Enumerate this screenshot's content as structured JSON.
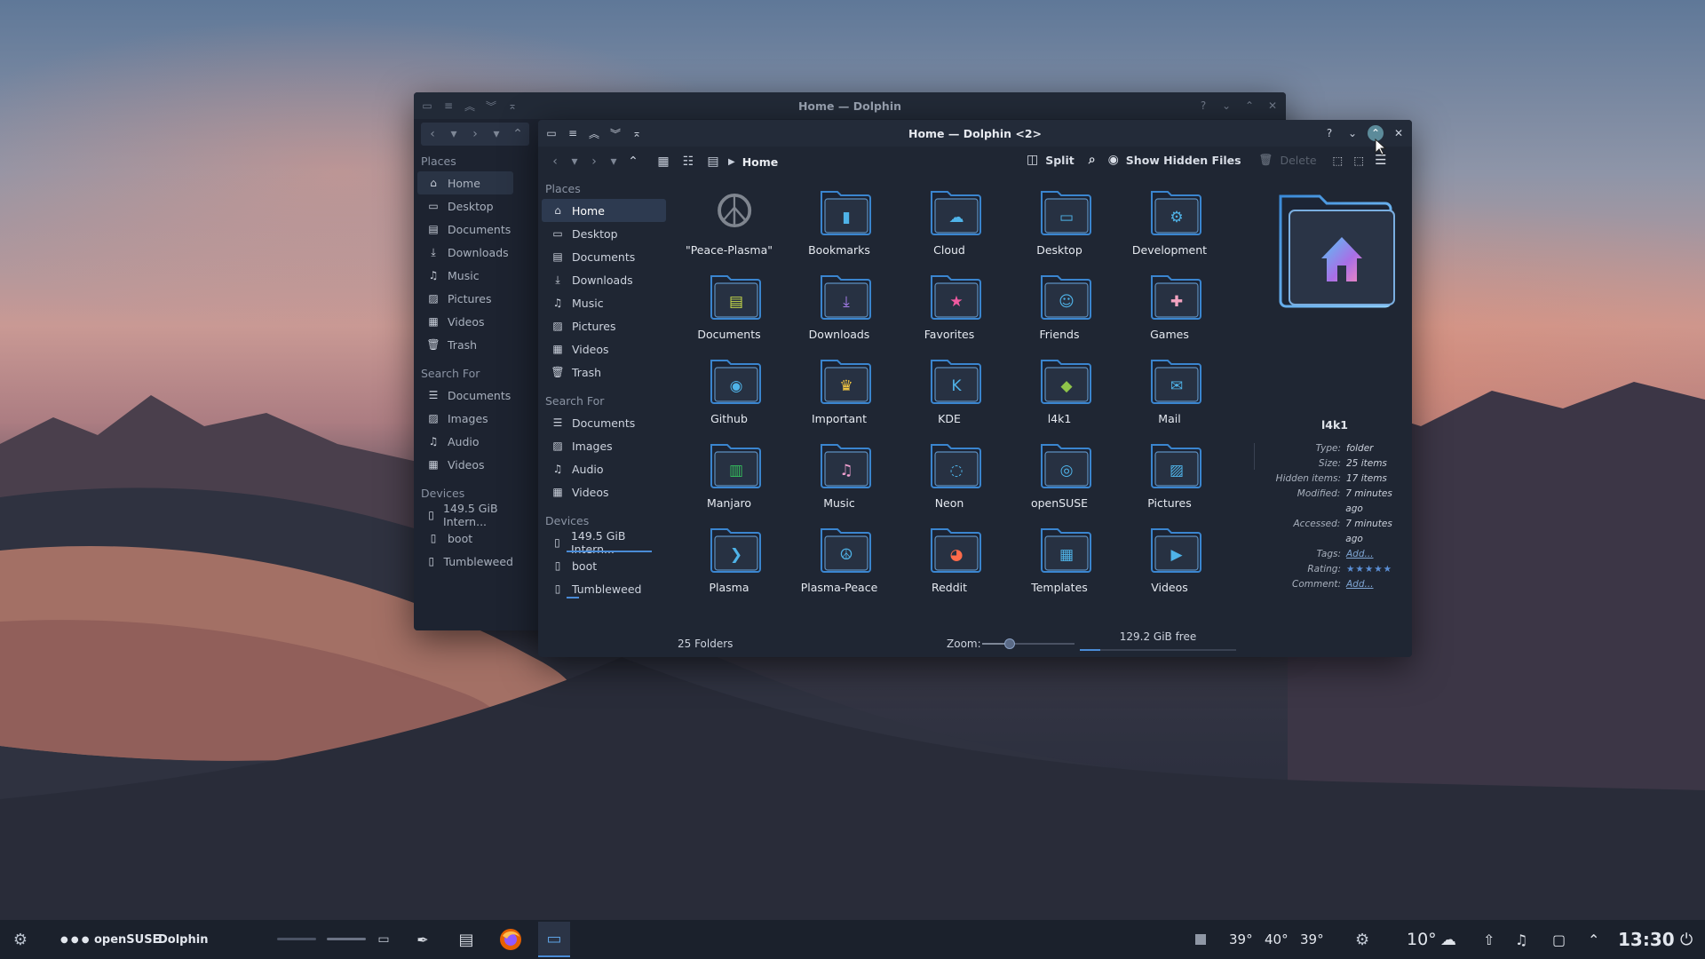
{
  "desktop": {
    "background": "desert-dunes-sunset"
  },
  "back_window": {
    "title": "Home — Dolphin",
    "places_header": "Places",
    "places": [
      "Home",
      "Desktop",
      "Documents",
      "Downloads",
      "Music",
      "Pictures",
      "Videos",
      "Trash"
    ],
    "search_header": "Search For",
    "search": [
      "Documents",
      "Images",
      "Audio",
      "Videos"
    ],
    "devices_header": "Devices",
    "devices": [
      "149.5 GiB Intern...",
      "boot",
      "Tumbleweed"
    ]
  },
  "front_window": {
    "title": "Home — Dolphin <2>",
    "breadcrumb": "Home",
    "toolbar": {
      "split": "Split",
      "show_hidden": "Show Hidden Files",
      "delete": "Delete"
    },
    "places_header": "Places",
    "places": [
      "Home",
      "Desktop",
      "Documents",
      "Downloads",
      "Music",
      "Pictures",
      "Videos",
      "Trash"
    ],
    "search_header": "Search For",
    "search": [
      "Documents",
      "Images",
      "Audio",
      "Videos"
    ],
    "devices_header": "Devices",
    "devices": [
      "149.5 GiB Intern...",
      "boot",
      "Tumbleweed"
    ],
    "folders": [
      {
        "name": "\"Peace-Plasma\"",
        "emblem": "peace-icon"
      },
      {
        "name": "Bookmarks",
        "emblem": "bookmark-icon"
      },
      {
        "name": "Cloud",
        "emblem": "cloud-icon"
      },
      {
        "name": "Desktop",
        "emblem": "desktop-icon"
      },
      {
        "name": "Development",
        "emblem": "gear-icon"
      },
      {
        "name": "Documents",
        "emblem": "document-icon"
      },
      {
        "name": "Downloads",
        "emblem": "download-icon"
      },
      {
        "name": "Favorites",
        "emblem": "star-icon"
      },
      {
        "name": "Friends",
        "emblem": "people-icon"
      },
      {
        "name": "Games",
        "emblem": "gamepad-icon"
      },
      {
        "name": "Github",
        "emblem": "github-icon"
      },
      {
        "name": "Important",
        "emblem": "trophy-icon"
      },
      {
        "name": "KDE",
        "emblem": "kde-icon"
      },
      {
        "name": "l4k1",
        "emblem": "chameleon-icon"
      },
      {
        "name": "Mail",
        "emblem": "mail-icon"
      },
      {
        "name": "Manjaro",
        "emblem": "manjaro-icon"
      },
      {
        "name": "Music",
        "emblem": "music-icon"
      },
      {
        "name": "Neon",
        "emblem": "neon-icon"
      },
      {
        "name": "openSUSE",
        "emblem": "opensuse-icon"
      },
      {
        "name": "Pictures",
        "emblem": "picture-icon"
      },
      {
        "name": "Plasma",
        "emblem": "plasma-icon"
      },
      {
        "name": "Plasma-Peace",
        "emblem": "peace-text-icon"
      },
      {
        "name": "Reddit",
        "emblem": "reddit-icon"
      },
      {
        "name": "Templates",
        "emblem": "template-icon"
      },
      {
        "name": "Videos",
        "emblem": "video-icon"
      }
    ],
    "info_panel": {
      "name": "l4k1",
      "type_label": "Type:",
      "type": "folder",
      "size_label": "Size:",
      "size": "25 items",
      "hidden_label": "Hidden items:",
      "hidden": "17 items",
      "modified_label": "Modified:",
      "modified": "7 minutes ago",
      "accessed_label": "Accessed:",
      "accessed": "7 minutes ago",
      "tags_label": "Tags:",
      "tags": "Add...",
      "rating_label": "Rating:",
      "rating": 5,
      "comment_label": "Comment:",
      "comment": "Add..."
    },
    "status": {
      "count": "25 Folders",
      "zoom_label": "Zoom:",
      "free": "129.2 GiB free",
      "free_fraction": 0.13,
      "zoom_fraction": 0.3
    }
  },
  "taskbar": {
    "distro": "openSUSE",
    "app": "Dolphin",
    "temps": [
      "39°",
      "40°",
      "39°"
    ],
    "weather": "10°",
    "clock": "13:30"
  },
  "colors": {
    "accent": "#4a8bd6",
    "folder_top": "#3b82c8",
    "folder_body": "#232c3d",
    "selection": "#2d3a50"
  }
}
